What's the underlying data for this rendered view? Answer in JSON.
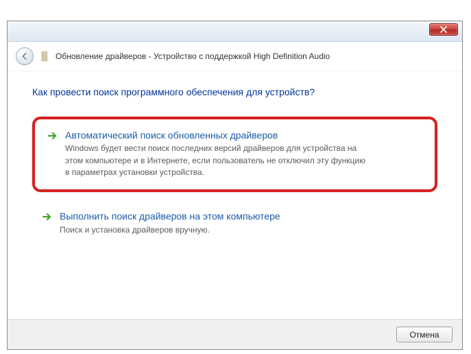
{
  "window": {
    "title": "Обновление драйверов - Устройство с поддержкой High Definition Audio"
  },
  "heading": "Как провести поиск программного обеспечения для устройств?",
  "options": [
    {
      "title": "Автоматический поиск обновленных драйверов",
      "description": "Windows будет вести поиск последних версий драйверов для устройства на этом компьютере и в Интернете, если пользователь не отключил эту функцию в параметрах установки устройства."
    },
    {
      "title": "Выполнить поиск драйверов на этом компьютере",
      "description": "Поиск и установка драйверов вручную."
    }
  ],
  "buttons": {
    "cancel": "Отмена"
  }
}
